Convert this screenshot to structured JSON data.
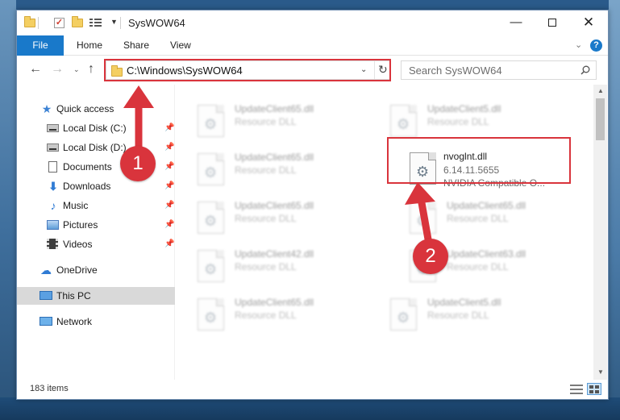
{
  "window": {
    "title": "SysWOW64",
    "minimize_label": "—",
    "close_label": "✕"
  },
  "ribbon": {
    "tabs": [
      "File",
      "Home",
      "Share",
      "View"
    ],
    "help_label": "?"
  },
  "address_bar": {
    "path": "C:\\Windows\\SysWOW64"
  },
  "search": {
    "placeholder": "Search SysWOW64"
  },
  "sidebar": {
    "items": [
      {
        "label": "Quick access",
        "icon": "star-icon",
        "pinned": false
      },
      {
        "label": "Local Disk (C:)",
        "icon": "drive-icon",
        "pinned": true
      },
      {
        "label": "Local Disk (D:)",
        "icon": "drive-icon",
        "pinned": true
      },
      {
        "label": "Documents",
        "icon": "documents-icon",
        "pinned": true
      },
      {
        "label": "Downloads",
        "icon": "downloads-icon",
        "pinned": true
      },
      {
        "label": "Music",
        "icon": "music-icon",
        "pinned": true
      },
      {
        "label": "Pictures",
        "icon": "pictures-icon",
        "pinned": true
      },
      {
        "label": "Videos",
        "icon": "videos-icon",
        "pinned": true
      },
      {
        "label": "OneDrive",
        "icon": "onedrive-icon",
        "pinned": false
      },
      {
        "label": "This PC",
        "icon": "this-pc-icon",
        "pinned": false,
        "selected": true
      },
      {
        "label": "Network",
        "icon": "network-icon",
        "pinned": false
      }
    ]
  },
  "files": [
    {
      "name": "UpdateClient65.dll",
      "line1": "Resource DLL",
      "line2": "",
      "highlighted": false
    },
    {
      "name": "UpdateClient5.dll",
      "line1": "Resource DLL",
      "line2": "",
      "highlighted": false
    },
    {
      "name": "UpdateClient65.dll",
      "line1": "Resource DLL",
      "line2": "",
      "highlighted": false
    },
    {
      "name": "nvoglnt.dll",
      "line1": "6.14.11.5655",
      "line2": "NVIDIA Compatible O...",
      "highlighted": true
    },
    {
      "name": "UpdateClient65.dll",
      "line1": "Resource DLL",
      "line2": "",
      "highlighted": false
    },
    {
      "name": "UpdateClient65.dll",
      "line1": "Resource DLL",
      "line2": "",
      "highlighted": false
    },
    {
      "name": "UpdateClient42.dll",
      "line1": "Resource DLL",
      "line2": "",
      "highlighted": false
    },
    {
      "name": "UpdateClient63.dll",
      "line1": "Resource DLL",
      "line2": "",
      "highlighted": false
    },
    {
      "name": "UpdateClient65.dll",
      "line1": "Resource DLL",
      "line2": "",
      "highlighted": false
    },
    {
      "name": "UpdateClient5.dll",
      "line1": "Resource DLL",
      "line2": "",
      "highlighted": false
    }
  ],
  "status": {
    "item_count": "183 items"
  },
  "annotations": [
    {
      "label": "1"
    },
    {
      "label": "2"
    }
  ],
  "colors": {
    "accent": "#1979ca",
    "annotation_red": "#d9343c",
    "selected_nav": "#d9d9d9"
  }
}
